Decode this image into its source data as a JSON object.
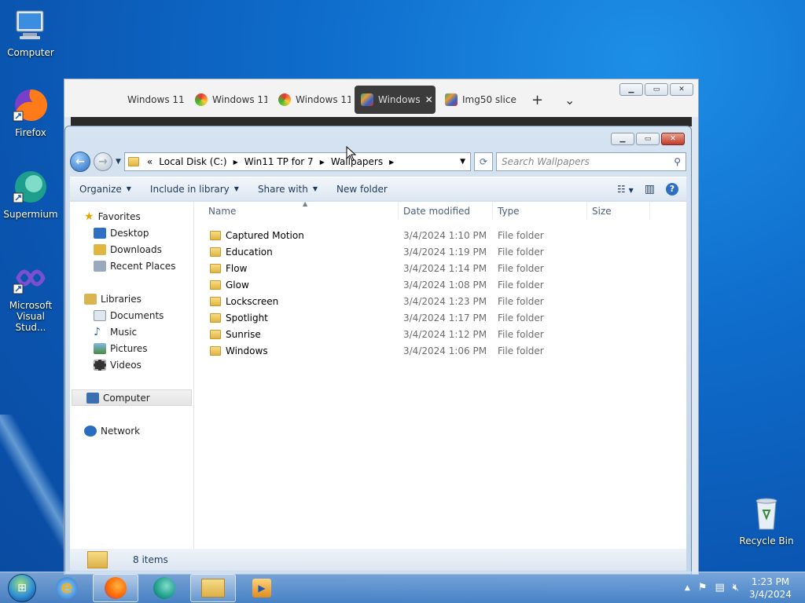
{
  "desktop": {
    "icons": [
      {
        "label": "Computer"
      },
      {
        "label": "Firefox"
      },
      {
        "label": "Supermium"
      },
      {
        "label": "Microsoft Visual Stud..."
      },
      {
        "label": "Recycle Bin"
      }
    ]
  },
  "browser": {
    "tabs": [
      {
        "label": "Windows 11"
      },
      {
        "label": "Windows 11"
      },
      {
        "label": "Windows 11"
      },
      {
        "label": "Windows",
        "active": true
      },
      {
        "label": "Img50 slice"
      }
    ],
    "new_tab": "+",
    "tab_list": "⌄"
  },
  "explorer": {
    "address": {
      "overflow": "«",
      "crumbs": [
        "Local Disk (C:)",
        "Win11 TP for 7",
        "Wallpapers"
      ]
    },
    "search_placeholder": "Search Wallpapers",
    "toolbar": {
      "organize": "Organize",
      "include": "Include in library",
      "share": "Share with",
      "new_folder": "New folder"
    },
    "nav": {
      "favorites": "Favorites",
      "desktop": "Desktop",
      "downloads": "Downloads",
      "recent": "Recent Places",
      "libraries": "Libraries",
      "documents": "Documents",
      "music": "Music",
      "pictures": "Pictures",
      "videos": "Videos",
      "computer": "Computer",
      "network": "Network"
    },
    "columns": {
      "name": "Name",
      "date": "Date modified",
      "type": "Type",
      "size": "Size"
    },
    "files": [
      {
        "name": "Captured Motion",
        "date": "3/4/2024 1:10 PM",
        "type": "File folder"
      },
      {
        "name": "Education",
        "date": "3/4/2024 1:19 PM",
        "type": "File folder"
      },
      {
        "name": "Flow",
        "date": "3/4/2024 1:14 PM",
        "type": "File folder"
      },
      {
        "name": "Glow",
        "date": "3/4/2024 1:08 PM",
        "type": "File folder"
      },
      {
        "name": "Lockscreen",
        "date": "3/4/2024 1:23 PM",
        "type": "File folder"
      },
      {
        "name": "Spotlight",
        "date": "3/4/2024 1:17 PM",
        "type": "File folder"
      },
      {
        "name": "Sunrise",
        "date": "3/4/2024 1:12 PM",
        "type": "File folder"
      },
      {
        "name": "Windows",
        "date": "3/4/2024 1:06 PM",
        "type": "File folder"
      }
    ],
    "status": "8 items"
  },
  "taskbar": {
    "time": "1:23 PM",
    "date": "3/4/2024"
  }
}
